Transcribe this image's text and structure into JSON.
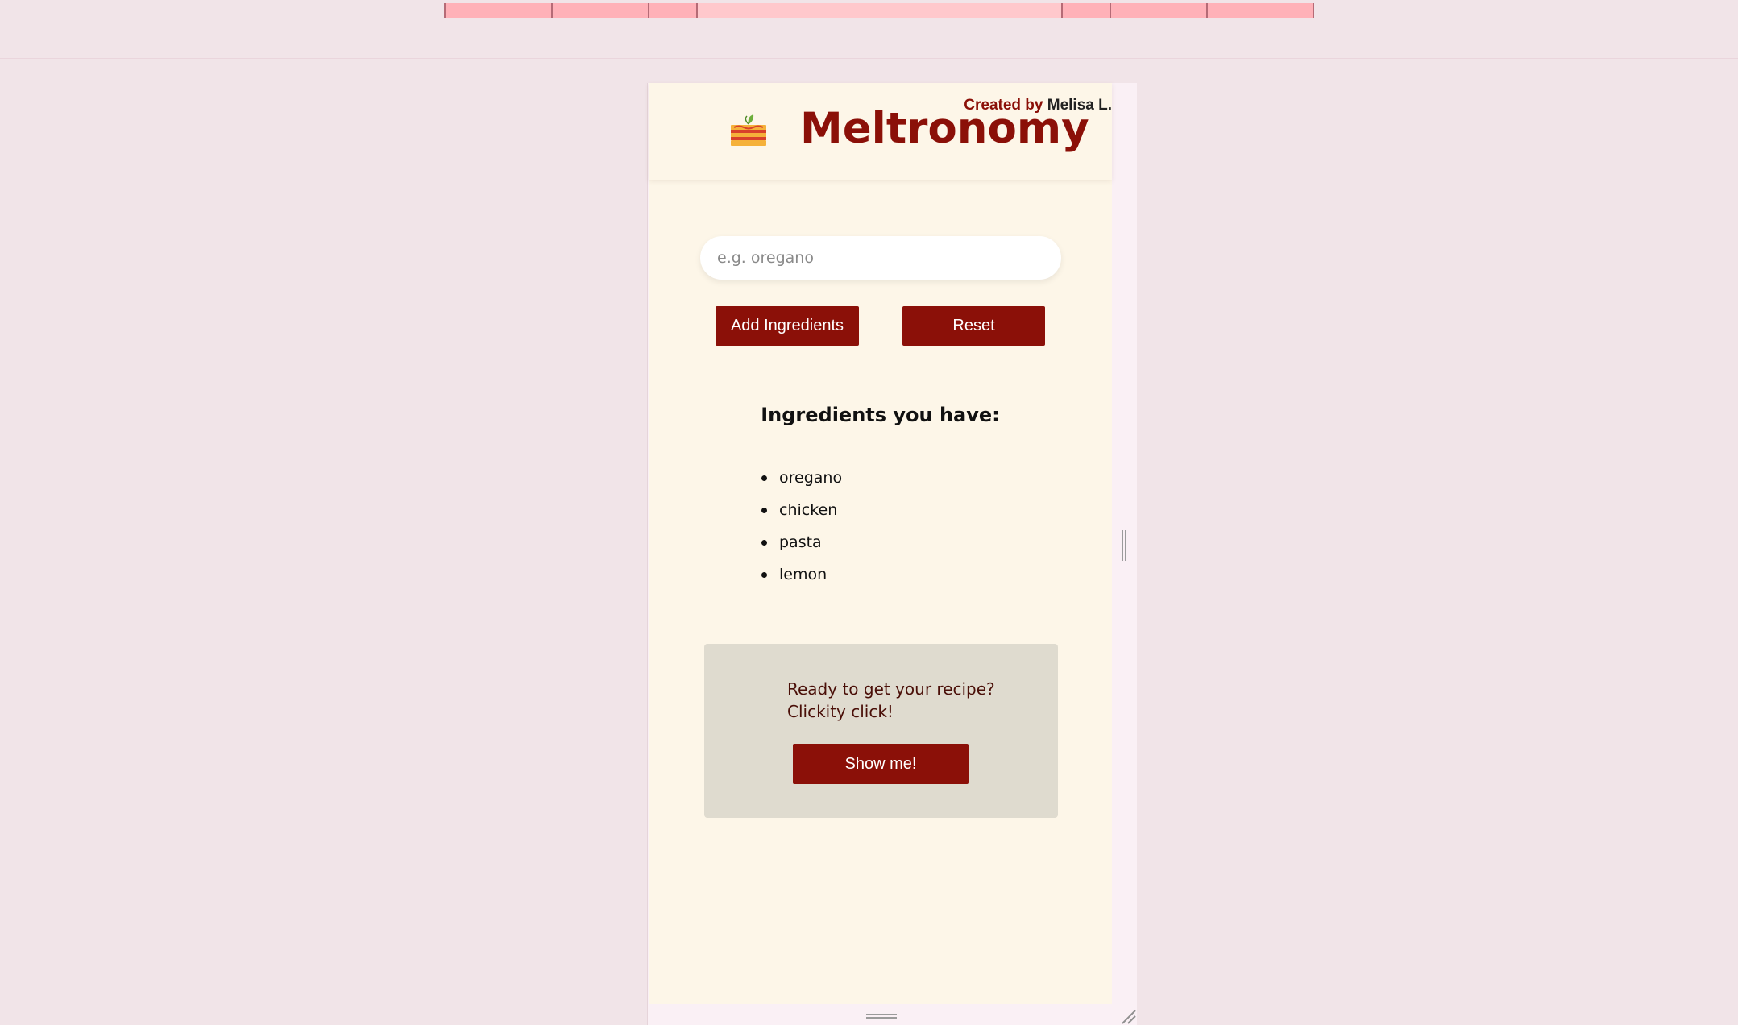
{
  "app": {
    "title": "Meltronomy",
    "credit_prefix": "Created by",
    "credit_author": "Melisa L.",
    "logo_icon": "lasagna-icon"
  },
  "search": {
    "placeholder": "e.g. oregano",
    "value": ""
  },
  "buttons": {
    "add_label": "Add Ingredients",
    "reset_label": "Reset",
    "show_label": "Show me!"
  },
  "ingredients": {
    "heading": "Ingredients you have:",
    "items": [
      "oregano",
      "chicken",
      "pasta",
      "lemon"
    ]
  },
  "cta": {
    "line1": "Ready to get your recipe?",
    "line2": "Clickity click!"
  },
  "colors": {
    "brand": "#8b1008",
    "app_background": "#fdf6e8",
    "page_background": "#f1e4e8",
    "cta_background": "#dfdbcf"
  }
}
